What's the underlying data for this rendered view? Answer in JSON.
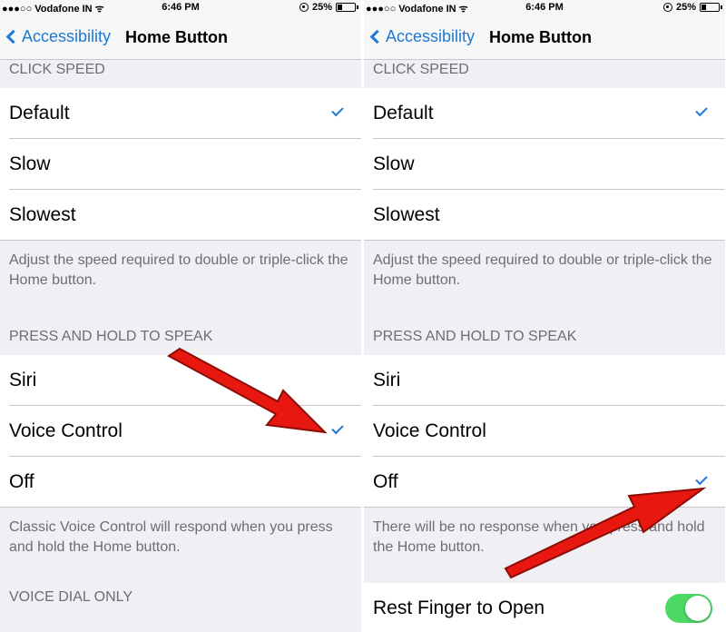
{
  "panels": [
    {
      "status": {
        "carrier": "●●●○○ Vodafone IN ᯤ",
        "time": "6:46 PM",
        "battery": "25%"
      },
      "nav": {
        "back_label": "Accessibility",
        "title": "Home Button"
      },
      "click_speed": {
        "header": "CLICK SPEED",
        "options": [
          "Default",
          "Slow",
          "Slowest"
        ],
        "selected": "Default",
        "footer": "Adjust the speed required to double or triple-click the Home button."
      },
      "press_hold": {
        "header": "PRESS AND HOLD TO SPEAK",
        "options": [
          "Siri",
          "Voice Control",
          "Off"
        ],
        "selected": "Voice Control",
        "footer": "Classic Voice Control will respond when you press and hold the Home button."
      },
      "voice_dial": {
        "header": "VOICE DIAL ONLY"
      }
    },
    {
      "status": {
        "carrier": "●●●○○ Vodafone IN ᯤ",
        "time": "6:46 PM",
        "battery": "25%"
      },
      "nav": {
        "back_label": "Accessibility",
        "title": "Home Button"
      },
      "click_speed": {
        "header": "CLICK SPEED",
        "options": [
          "Default",
          "Slow",
          "Slowest"
        ],
        "selected": "Default",
        "footer": "Adjust the speed required to double or triple-click the Home button."
      },
      "press_hold": {
        "header": "PRESS AND HOLD TO SPEAK",
        "options": [
          "Siri",
          "Voice Control",
          "Off"
        ],
        "selected": "Off",
        "footer": "There will be no response when you press and hold the Home button."
      },
      "rest_finger": {
        "label": "Rest Finger to Open",
        "enabled": true
      }
    }
  ],
  "colors": {
    "accent": "#1d79d3",
    "toggle_on": "#4cd964",
    "arrow": "#e8170f",
    "group_bg": "#efeff4"
  }
}
